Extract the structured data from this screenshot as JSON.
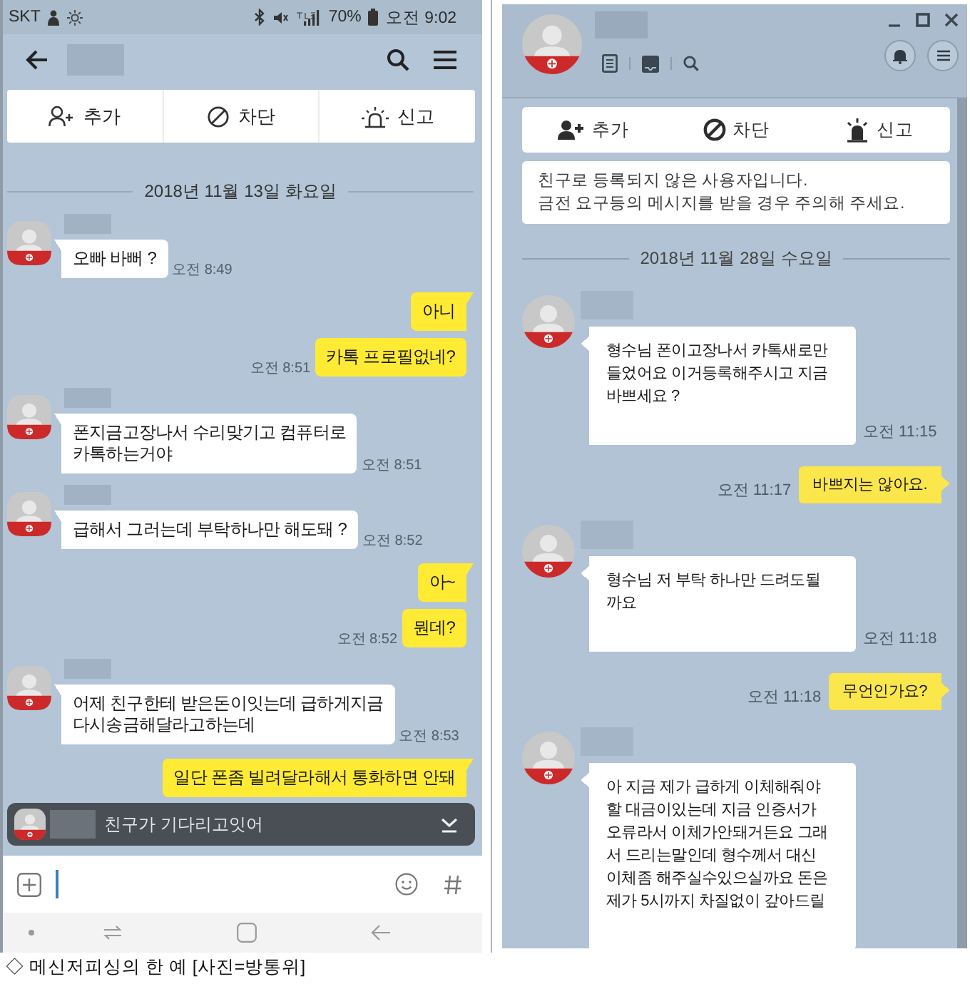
{
  "mobile": {
    "status_bar": {
      "carrier": "SKT",
      "battery": "70%",
      "time": "오전 9:02"
    },
    "actions": [
      {
        "kind": "add",
        "label": "추가"
      },
      {
        "kind": "block",
        "label": "차단"
      },
      {
        "kind": "report",
        "label": "신고"
      }
    ],
    "date": "2018년 11월 13일 화요일",
    "messages": [
      {
        "kind": "received",
        "text": "오빠 바뻐 ?",
        "time": "오전 8:49"
      },
      {
        "kind": "sent",
        "text": "아니"
      },
      {
        "kind": "sent",
        "text": "카톡 프로필없네?",
        "time": "오전 8:51"
      },
      {
        "kind": "received",
        "text": "폰지금고장나서 수리맞기고 컴퓨터로\n카톡하는거야",
        "time": "오전 8:51"
      },
      {
        "kind": "received",
        "text": "급해서 그러는데 부탁하나만 해도돼 ?",
        "time": "오전 8:52"
      },
      {
        "kind": "sent",
        "text": "아~"
      },
      {
        "kind": "sent",
        "text": "뭔데?",
        "time": "오전 8:52"
      },
      {
        "kind": "received",
        "text": "어제 친구한테 받은돈이잇는데 급하게지금\n다시송금해달라고하는데",
        "time": "오전 8:53"
      },
      {
        "kind": "sent",
        "text": "일단 폰좀 빌려달라해서 통화하면 안돼"
      }
    ],
    "notification": {
      "text": "친구가 기다리고잇어"
    }
  },
  "pc": {
    "actions": [
      {
        "kind": "add",
        "label": "추가"
      },
      {
        "kind": "block",
        "label": "차단"
      },
      {
        "kind": "report",
        "label": "신고"
      }
    ],
    "notice": "친구로 등록되지 않은 사용자입니다.\n금전 요구등의 메시지를 받을 경우 주의해 주세요.",
    "date": "2018년 11월 28일 수요일",
    "messages": [
      {
        "kind": "received",
        "text": "형수님 폰이고장나서 카톡새로만\n들었어요 이거등록해주시고 지금\n바쁘세요 ?",
        "time": "오전 11:15"
      },
      {
        "kind": "sent",
        "text": "바쁘지는 않아요.",
        "time": "오전 11:17"
      },
      {
        "kind": "received",
        "text": "형수님 저 부탁 하나만 드려도될\n까요",
        "time": "오전 11:18"
      },
      {
        "kind": "sent",
        "text": "무언인가요?",
        "time": "오전 11:18"
      },
      {
        "kind": "received",
        "text": "아 지금 제가 급하게 이체해줘야\n할 대금이있는데 지금 인증서가\n오류라서 이체가안돼거든요 그래\n서 드리는말인데 형수께서 대신\n이체좀 해주실수있으실까요 돈은\n제가 5시까지 차질없이 갚아드릴"
      }
    ]
  },
  "caption": "◇ 메신저피싱의 한 예 [사진=방통위]"
}
